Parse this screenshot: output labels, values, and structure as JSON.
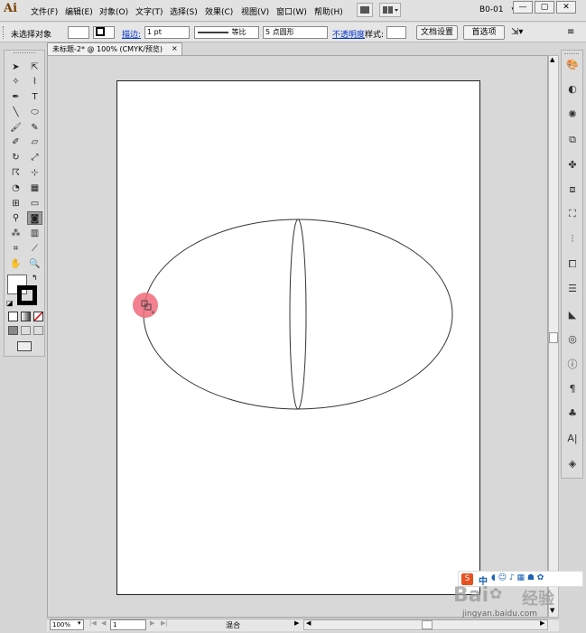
{
  "app": {
    "logo": "Ai"
  },
  "menu": {
    "items": [
      "文件(F)",
      "编辑(E)",
      "对象(O)",
      "文字(T)",
      "选择(S)",
      "效果(C)",
      "视图(V)",
      "窗口(W)",
      "帮助(H)"
    ],
    "workspace": "B0-01",
    "workspace_arrow": "▾"
  },
  "window_controls": {
    "minimize": "—",
    "restore": "▢",
    "close": "✕"
  },
  "control_bar": {
    "selection_status": "未选择对象",
    "stroke_label": "描边:",
    "stroke_weight": "1 pt",
    "profile_label": "等比",
    "brush_label": "5 点圆形",
    "opacity_label": "不透明度",
    "style_label": "样式:",
    "doc_setup_button": "文档设置",
    "prefs_button": "首选项"
  },
  "document": {
    "tab_title": "未标题-2* @ 100% (CMYK/预览)",
    "tab_close": "×"
  },
  "status_bar": {
    "zoom": "100%",
    "page": "1",
    "mode": "混合"
  },
  "watermark": {
    "ime_text": "中",
    "brand": "Bai",
    "brand2": "经验",
    "url": "jingyan.baidu.com"
  },
  "colors": {
    "cursor_highlight": "#f06a7a",
    "artboard_border": "#222222",
    "canvas": "#d8d8d8"
  }
}
